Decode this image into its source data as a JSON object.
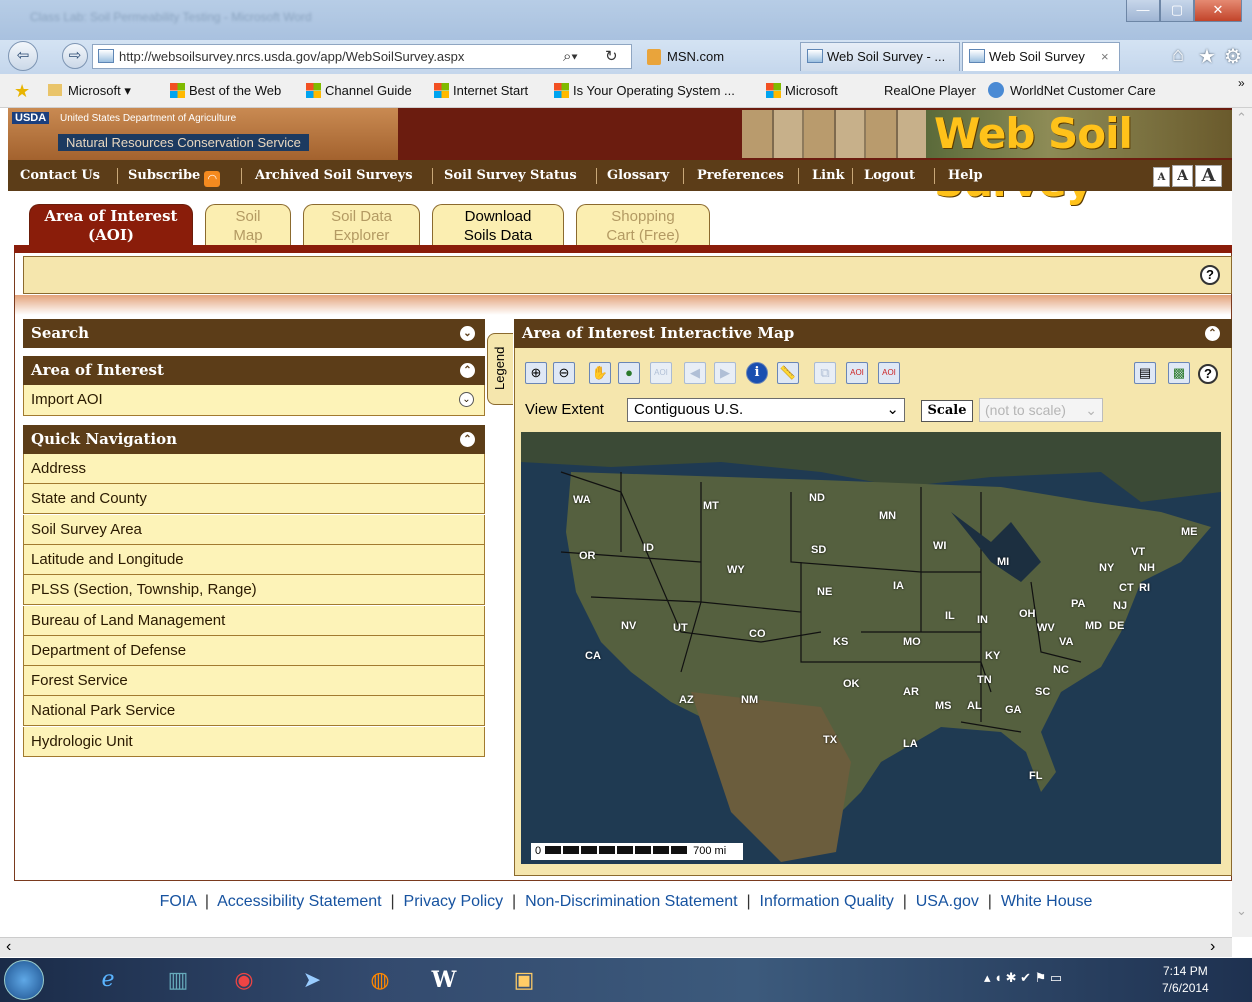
{
  "browser": {
    "window_title": "Class Lab: Soil Permeability Testing - Microsoft Word",
    "address": "http://websoilsurvey.nrcs.usda.gov/app/WebSoilSurvey.aspx",
    "address_search_icon": "search-icon",
    "tabs": [
      {
        "label": "MSN.com"
      },
      {
        "label": "Web Soil Survey - ..."
      },
      {
        "label": "Web Soil Survey",
        "close": "×"
      }
    ],
    "favorites": [
      {
        "label": "Microsoft ▾"
      },
      {
        "label": "Best of the Web"
      },
      {
        "label": "Channel Guide"
      },
      {
        "label": "Internet Start"
      },
      {
        "label": "Is Your Operating System ..."
      },
      {
        "label": "Microsoft"
      },
      {
        "label": "RealOne Player"
      },
      {
        "label": "WorldNet Customer Care"
      }
    ],
    "chevron": "»"
  },
  "banner": {
    "usda_tag": "USDA",
    "agency_line1": "United States Department of Agriculture",
    "agency_line2": "Natural Resources Conservation Service",
    "brand": "Web Soil Survey"
  },
  "menu": [
    {
      "label": "Contact Us"
    },
    {
      "label": "Subscribe"
    },
    {
      "label": "Archived Soil Surveys"
    },
    {
      "label": "Soil Survey Status"
    },
    {
      "label": "Glossary"
    },
    {
      "label": "Preferences"
    },
    {
      "label": "Link"
    },
    {
      "label": "Logout"
    },
    {
      "label": "Help"
    }
  ],
  "font_sizes": [
    "A",
    "A",
    "A"
  ],
  "page_tabs": [
    {
      "line1": "Area of Interest",
      "line2": "(AOI)",
      "state": "active"
    },
    {
      "line1": "Soil",
      "line2": "Map",
      "state": "disabled"
    },
    {
      "line1": "Soil Data",
      "line2": "Explorer",
      "state": "disabled"
    },
    {
      "line1": "Download",
      "line2": "Soils Data",
      "state": "enabled"
    },
    {
      "line1": "Shopping",
      "line2": "Cart (Free)",
      "state": "disabled"
    }
  ],
  "help_label": "?",
  "left_panel": {
    "search_title": "Search",
    "aoi_title": "Area of Interest",
    "import_aoi": "Import AOI",
    "quick_nav_title": "Quick Navigation",
    "quick_nav_items": [
      "Address",
      "State and County",
      "Soil Survey Area",
      "Latitude and Longitude",
      "PLSS (Section, Township, Range)",
      "Bureau of Land Management",
      "Department of Defense",
      "Forest Service",
      "National Park Service",
      "Hydrologic Unit"
    ]
  },
  "map_panel": {
    "title": "Area of Interest Interactive Map",
    "legend_tab": "Legend",
    "view_extent_label": "View Extent",
    "view_extent_value": "Contiguous U.S.",
    "scale_button": "Scale",
    "scale_value": "(not to scale)",
    "scalebar_start": "0",
    "scalebar_end": "700 mi",
    "states": [
      "WA",
      "OR",
      "CA",
      "ID",
      "NV",
      "MT",
      "WY",
      "UT",
      "AZ",
      "CO",
      "NM",
      "ND",
      "SD",
      "NE",
      "KS",
      "OK",
      "TX",
      "MN",
      "IA",
      "MO",
      "AR",
      "LA",
      "WI",
      "IL",
      "MI",
      "IN",
      "OH",
      "KY",
      "TN",
      "MS",
      "AL",
      "GA",
      "FL",
      "SC",
      "NC",
      "VA",
      "WV",
      "PA",
      "NY",
      "MD",
      "DE",
      "NJ",
      "CT",
      "RI",
      "VT",
      "NH",
      "ME"
    ]
  },
  "footer": [
    "FOIA",
    "Accessibility Statement",
    "Privacy Policy",
    "Non-Discrimination Statement",
    "Information Quality",
    "USA.gov",
    "White House"
  ],
  "clock": {
    "time": "7:14 PM",
    "date": "7/6/2014"
  }
}
